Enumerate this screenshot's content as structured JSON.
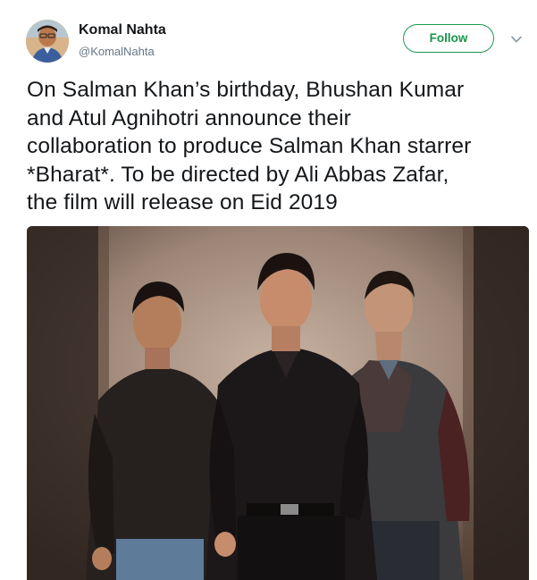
{
  "author": {
    "name": "Komal Nahta",
    "handle": "@KomalNahta",
    "avatar_icon": "profile-photo"
  },
  "actions": {
    "follow_label": "Follow",
    "menu_icon": "chevron-down-icon"
  },
  "tweet": {
    "lines": [
      "On Salman Khan’s birthday, Bhushan Kumar",
      "and Atul Agnihotri announce their",
      "collaboration to produce Salman Khan starrer",
      "*Bharat*. To be directed by Ali Abbas Zafar,",
      "the film will release on Eid 2019"
    ]
  },
  "media": {
    "type": "photo",
    "description_icon": "photo-three-men"
  },
  "colors": {
    "follow_accent": "#17954a",
    "text_primary": "#14171a",
    "text_secondary": "#657786"
  }
}
